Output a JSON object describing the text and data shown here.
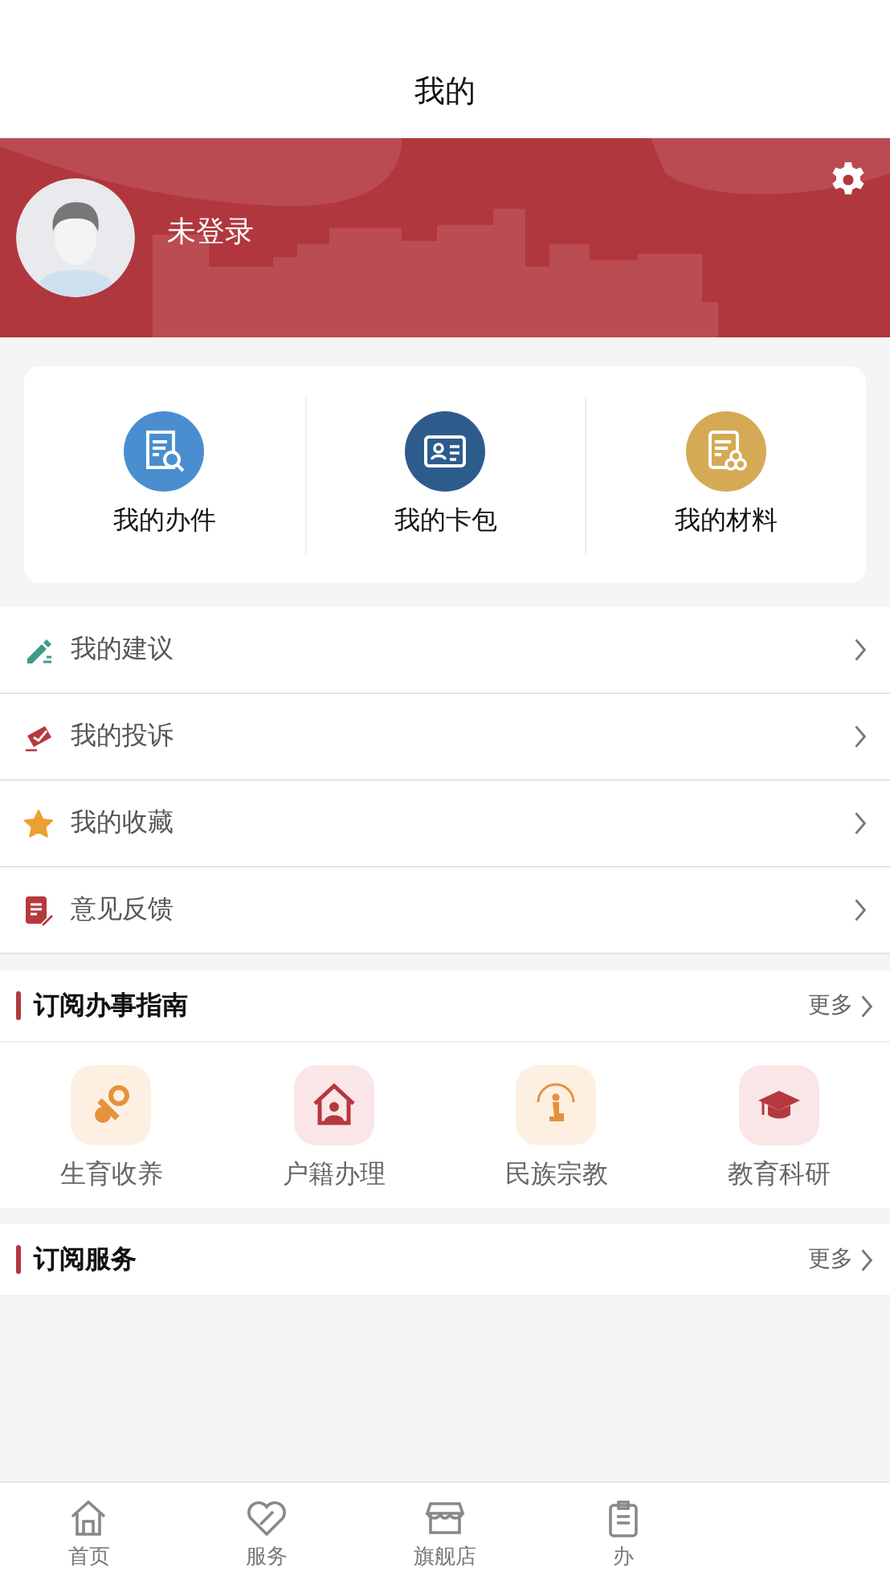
{
  "header": {
    "title": "我的"
  },
  "profile": {
    "name": "未登录"
  },
  "quick_actions": [
    {
      "label": "我的办件",
      "kind": "docs",
      "color": "#4a8ed0"
    },
    {
      "label": "我的卡包",
      "kind": "card",
      "color": "#2d5c8c"
    },
    {
      "label": "我的材料",
      "kind": "material",
      "color": "#d4aa55"
    }
  ],
  "menu": [
    {
      "label": "我的建议",
      "kind": "suggest"
    },
    {
      "label": "我的投诉",
      "kind": "complain"
    },
    {
      "label": "我的收藏",
      "kind": "favorite"
    },
    {
      "label": "意见反馈",
      "kind": "feedback"
    }
  ],
  "guide_section": {
    "title": "订阅办事指南",
    "more": "更多",
    "items": [
      {
        "label": "生育收养",
        "kind": "baby"
      },
      {
        "label": "户籍办理",
        "kind": "house"
      },
      {
        "label": "民族宗教",
        "kind": "religion"
      },
      {
        "label": "教育科研",
        "kind": "education"
      }
    ]
  },
  "service_section": {
    "title": "订阅服务",
    "more": "更多"
  },
  "tab_bar": [
    {
      "label": "首页",
      "kind": "home",
      "selected": false
    },
    {
      "label": "服务",
      "kind": "heart",
      "selected": false
    },
    {
      "label": "旗舰店",
      "kind": "store",
      "selected": false
    },
    {
      "label": "办",
      "kind": "clipboard",
      "selected": false
    }
  ]
}
